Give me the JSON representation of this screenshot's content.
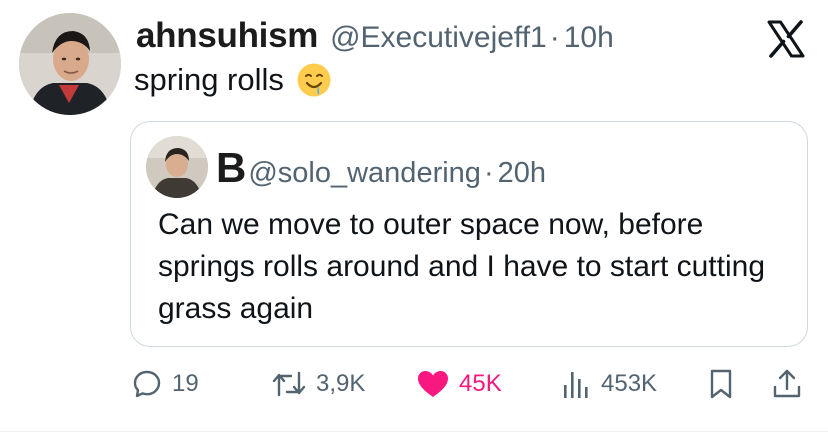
{
  "tweet": {
    "display_name": "ahnsuhism",
    "handle": "@Executivejeff1",
    "separator": "·",
    "time": "10h",
    "text": "spring rolls",
    "emoji": "drooling-face"
  },
  "quoted": {
    "display_name": "B",
    "handle": "@solo_wandering",
    "separator": "·",
    "time": "20h",
    "text": "Can we move to outer space now, before springs rolls around and I have to start cutting grass again"
  },
  "actions": {
    "replies": "19",
    "reposts": "3,9K",
    "likes": "45K",
    "views": "453K"
  },
  "colors": {
    "text": "#0f1419",
    "muted": "#536471",
    "like": "#f91880",
    "border": "#cfd9de"
  },
  "icons": [
    "x-logo-icon",
    "reply-icon",
    "repost-icon",
    "heart-icon",
    "views-icon",
    "bookmark-icon",
    "share-icon"
  ]
}
